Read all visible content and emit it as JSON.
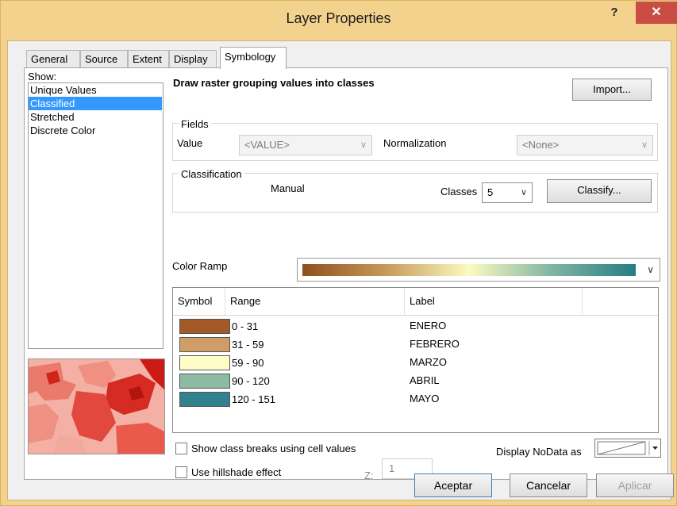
{
  "window": {
    "title": "Layer Properties",
    "help": "?",
    "close": "✕"
  },
  "tabs": [
    "General",
    "Source",
    "Extent",
    "Display",
    "Symbology"
  ],
  "show": {
    "label": "Show:",
    "items": [
      "Unique Values",
      "Classified",
      "Stretched",
      "Discrete Color"
    ],
    "selected": "Classified"
  },
  "symbology": {
    "heading": "Draw raster grouping values into classes",
    "import_label": "Import...",
    "fields": {
      "title": "Fields",
      "value_label": "Value",
      "value_field": "<VALUE>",
      "normalization_label": "Normalization",
      "normalization_field": "<None>"
    },
    "classification": {
      "title": "Classification",
      "method": "Manual",
      "classes_label": "Classes",
      "classes_value": "5",
      "classify_label": "Classify..."
    },
    "color_ramp_label": "Color Ramp",
    "ramp_colors": [
      "#8f4f1e",
      "#c69a5a",
      "#fbfbc0",
      "#7fb4a3",
      "#257d84"
    ],
    "table": {
      "headers": [
        "Symbol",
        "Range",
        "Label"
      ],
      "rows": [
        {
          "color": "#a35a27",
          "range": "0 - 31",
          "label": "ENERO"
        },
        {
          "color": "#d19d66",
          "range": "31 - 59",
          "label": "FEBRERO"
        },
        {
          "color": "#fffdc7",
          "range": "59 - 90",
          "label": "MARZO"
        },
        {
          "color": "#8dbaa2",
          "range": "90 - 120",
          "label": "ABRIL"
        },
        {
          "color": "#31828c",
          "range": "120 - 151",
          "label": "MAYO"
        }
      ]
    },
    "show_class_breaks_label": "Show class breaks using cell values",
    "hillshade_label": "Use hillshade effect",
    "z_label": "Z:",
    "z_value": "1",
    "nodata_label": "Display NoData as"
  },
  "footer": {
    "ok": "Aceptar",
    "cancel": "Cancelar",
    "apply": "Aplicar"
  }
}
